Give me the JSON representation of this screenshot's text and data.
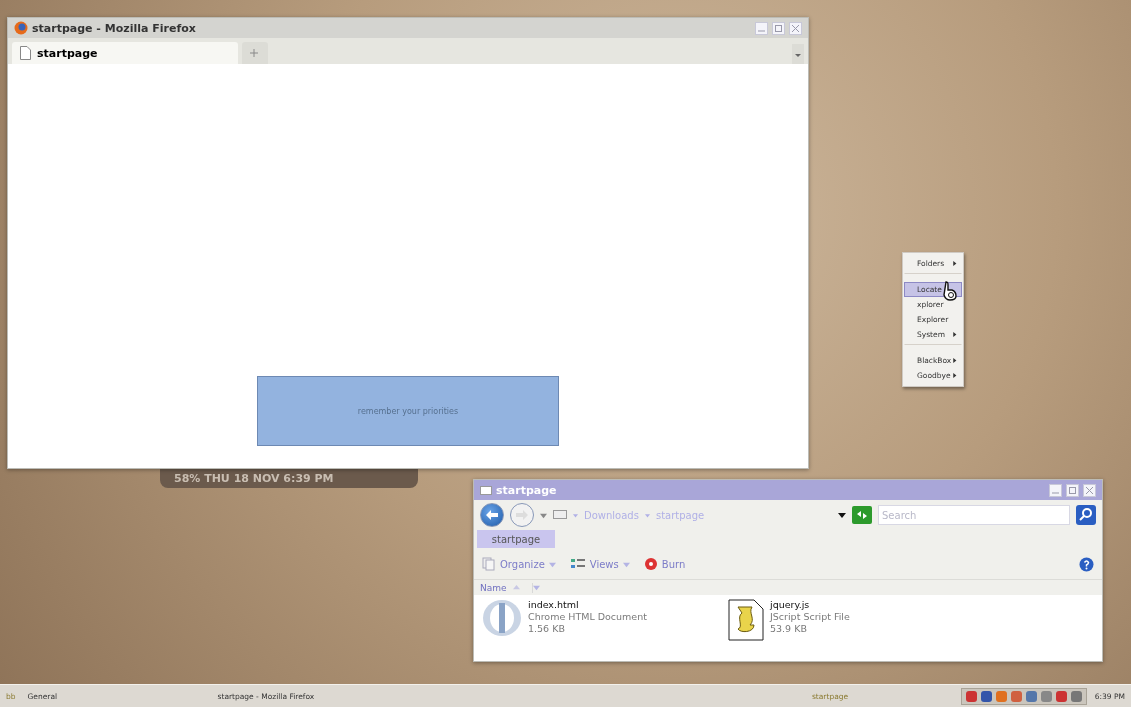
{
  "firefox_window": {
    "title": "startpage - Mozilla Firefox",
    "tabs": [
      {
        "label": "startpage",
        "selected": true
      }
    ],
    "note": "remember your priorities"
  },
  "clock_widget": {
    "text": "58% THU 18 NOV 6:39 PM"
  },
  "context_menu": {
    "items": [
      {
        "label": "Folders",
        "submenu": true,
        "selected": false,
        "separator_after": true
      },
      {
        "label": "Locate",
        "submenu": false,
        "selected": true,
        "separator_after": false
      },
      {
        "label": "xplorer",
        "submenu": false,
        "selected": false,
        "separator_after": false
      },
      {
        "label": "Explorer",
        "submenu": false,
        "selected": false,
        "separator_after": false
      },
      {
        "label": "System",
        "submenu": true,
        "selected": false,
        "separator_after": true
      },
      {
        "label": "BlackBox",
        "submenu": true,
        "selected": false,
        "separator_after": false
      },
      {
        "label": "Goodbye",
        "submenu": true,
        "selected": false,
        "separator_after": false
      }
    ]
  },
  "explorer_window": {
    "title": "startpage",
    "breadcrumb": [
      "Downloads",
      "startpage"
    ],
    "search": {
      "placeholder": "Search"
    },
    "tabs": [
      {
        "label": "startpage",
        "selected": true
      }
    ],
    "toolbar": [
      {
        "label": "Organize",
        "kind": "organize",
        "dropdown": true
      },
      {
        "label": "Views",
        "kind": "views",
        "dropdown": true
      },
      {
        "label": "Burn",
        "kind": "burn",
        "dropdown": false
      }
    ],
    "columns": [
      {
        "label": "Name",
        "sorted": true
      }
    ],
    "files": [
      {
        "name": "index.html",
        "type": "Chrome HTML Document",
        "size": "1.56 KB",
        "kind": "html"
      },
      {
        "name": "jquery.js",
        "type": "JScript Script File",
        "size": "53.9 KB",
        "kind": "script"
      }
    ]
  },
  "taskbar": {
    "menu_label": "bb",
    "workspace": "General",
    "tasks": [
      {
        "label": "startpage - Mozilla Firefox",
        "selected": false
      },
      {
        "label": "startpage",
        "selected": true
      }
    ],
    "clock": "6:39 PM"
  }
}
